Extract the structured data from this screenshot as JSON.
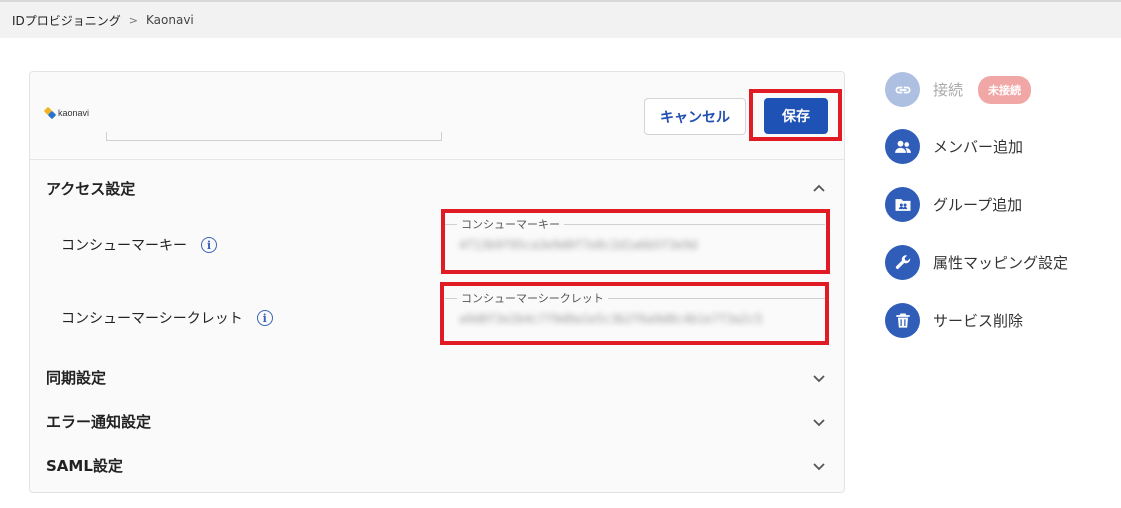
{
  "breadcrumb": {
    "parent": "IDプロビジョニング",
    "separator": ">",
    "current": "Kaonavi"
  },
  "service": {
    "logo_text": "kaonavi",
    "logo_colors": [
      "#f2b324",
      "#2b73c9"
    ]
  },
  "buttons": {
    "cancel": "キャンセル",
    "save": "保存"
  },
  "sections": {
    "access": {
      "title": "アクセス設定",
      "expanded": true
    },
    "sync": {
      "title": "同期設定"
    },
    "error": {
      "title": "エラー通知設定"
    },
    "saml": {
      "title": "SAML設定"
    }
  },
  "fields": {
    "consumer_key": {
      "label": "コンシューマーキー",
      "legend": "コンシューマーキー",
      "value": "4f13b9f95ca3e9d0f7e8c2d1a6b5f3e9d"
    },
    "consumer_secret": {
      "label": "コンシューマーシークレット",
      "legend": "コンシューマーシークレット",
      "value": "a9d8f3e2b4c7f9d8a1e5c3b2f6a9d8c4b1e7f3a2c5"
    }
  },
  "sidebar": {
    "connect": {
      "label": "接続",
      "badge": "未接続",
      "icon": "link-icon",
      "disabled": true
    },
    "add_member": {
      "label": "メンバー追加",
      "icon": "users-icon"
    },
    "add_group": {
      "label": "グループ追加",
      "icon": "group-folder-icon"
    },
    "attribute_mapping": {
      "label": "属性マッピング設定",
      "icon": "wrench-icon"
    },
    "delete_service": {
      "label": "サービス削除",
      "icon": "trash-icon"
    }
  },
  "colors": {
    "primary": "#1e52b4",
    "highlight": "#e01b24",
    "badge": "#f1a7a5",
    "disabled_icon": "#aec0e2"
  }
}
